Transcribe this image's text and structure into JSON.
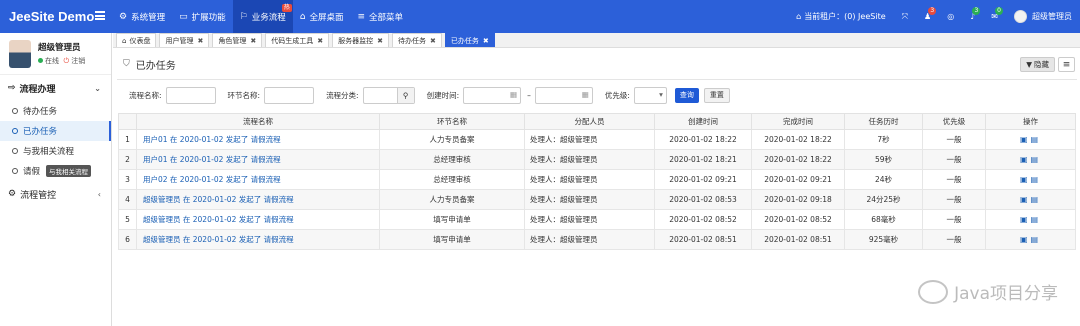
{
  "app": {
    "title": "JeeSite Demo"
  },
  "topnav": [
    {
      "icon": "⚙",
      "label": "系统管理"
    },
    {
      "icon": "▭",
      "label": "扩展功能"
    },
    {
      "icon": "⚐",
      "label": "业务流程",
      "badge": "热"
    },
    {
      "icon": "⌂",
      "label": "全屏桌面"
    },
    {
      "icon": "≡",
      "label": "全部菜单"
    }
  ],
  "topright": {
    "tenant": "当前租户：(0) JeeSite",
    "badge_alert": "3",
    "badge_msg": "0",
    "user": "超级管理员"
  },
  "user": {
    "name": "超级管理员",
    "status": "在线",
    "logout": "注销"
  },
  "sidebar": {
    "group1": "流程办理",
    "items": [
      "待办任务",
      "已办任务",
      "与我相关流程",
      "请假"
    ],
    "tooltip": "与我相关流程",
    "group2": "流程管控"
  },
  "tabs": [
    {
      "label": "仪表盘",
      "icon": "⌂"
    },
    {
      "label": "用户管理"
    },
    {
      "label": "角色管理"
    },
    {
      "label": "代码生成工具"
    },
    {
      "label": "服务器监控"
    },
    {
      "label": "待办任务"
    },
    {
      "label": "已办任务"
    }
  ],
  "page": {
    "title": "已办任务",
    "hide_btn": "隐藏"
  },
  "filter": {
    "proc_name": "流程名称:",
    "step_name": "环节名称:",
    "category": "流程分类:",
    "create_time": "创建时间:",
    "dash": "–",
    "priority": "优先级:",
    "query": "查询",
    "reset": "重置"
  },
  "table": {
    "headers": [
      "流程名称",
      "环节名称",
      "分配人员",
      "创建时间",
      "完成时间",
      "任务历时",
      "优先级",
      "操作"
    ],
    "rows": [
      {
        "n": "1",
        "name": "用户01 在 2020-01-02 发起了 请假流程",
        "step": "人力专员备案",
        "assign": "处理人：超级管理员",
        "created": "2020-01-02 18:22",
        "done": "2020-01-02 18:22",
        "dur": "7秒",
        "pri": "一般"
      },
      {
        "n": "2",
        "name": "用户01 在 2020-01-02 发起了 请假流程",
        "step": "总经理审核",
        "assign": "处理人：超级管理员",
        "created": "2020-01-02 18:21",
        "done": "2020-01-02 18:22",
        "dur": "59秒",
        "pri": "一般"
      },
      {
        "n": "3",
        "name": "用户02 在 2020-01-02 发起了 请假流程",
        "step": "总经理审核",
        "assign": "处理人：超级管理员",
        "created": "2020-01-02 09:21",
        "done": "2020-01-02 09:21",
        "dur": "24秒",
        "pri": "一般"
      },
      {
        "n": "4",
        "name": "超级管理员 在 2020-01-02 发起了 请假流程",
        "step": "人力专员备案",
        "assign": "处理人：超级管理员",
        "created": "2020-01-02 08:53",
        "done": "2020-01-02 09:18",
        "dur": "24分25秒",
        "pri": "一般"
      },
      {
        "n": "5",
        "name": "超级管理员 在 2020-01-02 发起了 请假流程",
        "step": "填写申请单",
        "assign": "处理人：超级管理员",
        "created": "2020-01-02 08:52",
        "done": "2020-01-02 08:52",
        "dur": "68毫秒",
        "pri": "一般"
      },
      {
        "n": "6",
        "name": "超级管理员 在 2020-01-02 发起了 请假流程",
        "step": "填写申请单",
        "assign": "处理人：超级管理员",
        "created": "2020-01-02 08:51",
        "done": "2020-01-02 08:51",
        "dur": "925毫秒",
        "pri": "一般"
      }
    ]
  },
  "watermark": "Java项目分享"
}
